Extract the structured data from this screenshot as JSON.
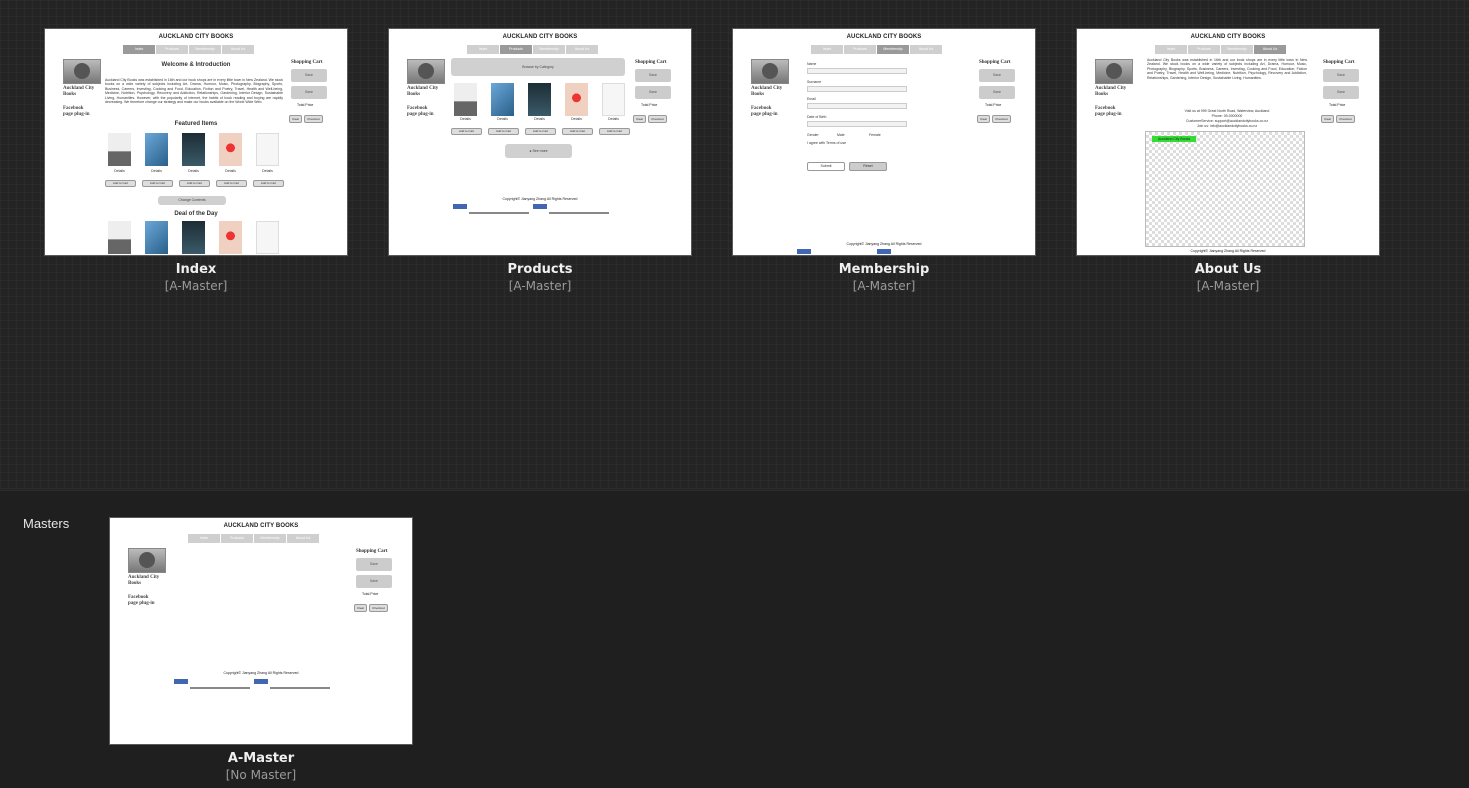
{
  "site": {
    "title": "AUCKLAND CITY BOOKS",
    "nav": [
      "Index",
      "Products",
      "Membership",
      "About Us"
    ],
    "side_logo_text": "Auckland City Books",
    "side_plugin_text": "Facebook page plug-in",
    "cart_label": "Shopping Cart",
    "cart_buttons": [
      "Save",
      "Save"
    ],
    "total_price": "Total Price",
    "clear": "Clear",
    "checkout": "Checkout",
    "copyright": "Copyright© Jianyang Zhang All Rights Reserved"
  },
  "pages": [
    {
      "name": "Index",
      "master": "[A-Master]",
      "active_nav": 0
    },
    {
      "name": "Products",
      "master": "[A-Master]",
      "active_nav": 1
    },
    {
      "name": "Membership",
      "master": "[A-Master]",
      "active_nav": 2
    },
    {
      "name": "About Us",
      "master": "[A-Master]",
      "active_nav": 3
    }
  ],
  "index_page": {
    "welcome": "Welcome & Introduction",
    "intro": "Auckland City Books was established in 16th and our book shops are in every little town in New Zealand. We stock books on a wide variety of subjects including Art, Drama, Humour, Music, Photography, Biography, Sports, Business, Careers, Investing, Cooking and Food, Education, Fiction and Poetry, Travel, Health and Well-being, Medicine, Nutrition, Psychology, Recovery and Addiction, Relationships, Gardening, Interior Design, Sustainable Living, Humanities. However, with the popularity of internet, the habits of book reading and buying are rapidly decreasing. We therefore change our strategy and make our books available on the World Wide Web.",
    "featured": "Featured Items",
    "details": "Details",
    "add_to_cart": "Add to Cart",
    "change_contents": "Change Contents",
    "deal": "Deal of the Day"
  },
  "products_page": {
    "category": "Browse by Category",
    "see_more": "See more"
  },
  "membership_page": {
    "fields": [
      "Name",
      "Surname",
      "Email",
      "Date of Birth"
    ],
    "gender": "Gender",
    "male": "Male",
    "female": "Female",
    "terms": "I agree with Terms of use",
    "submit": "Submit",
    "reset": "Reset"
  },
  "about_page": {
    "intro": "Auckland City Books was established in 16th and our book shops are in every little town in New Zealand. We stock books on a wide variety of subjects including Art, Drama, Humour, Music, Photography, Biography, Sports, Business, Careers, Investing, Cooking and Food, Education, Fiction and Poetry, Travel, Health and Well-being, Medicine, Nutrition, Psychology, Recovery and Addiction, Relationships, Gardening, Interior Design, Sustainable Living, Humanities.",
    "address": "Visit us at 999 Great North Road, Waterview, Auckland",
    "phone": "Phone: 09-0000000",
    "email": "CustomerService: support@aucklandcitybooks.co.nz",
    "join": "Join us: info@aucklandcitybooks.co.nz",
    "map_label": "Auckland City Books"
  },
  "masters_section": {
    "heading": "Masters",
    "items": [
      {
        "name": "A-Master",
        "master": "[No Master]"
      }
    ]
  }
}
